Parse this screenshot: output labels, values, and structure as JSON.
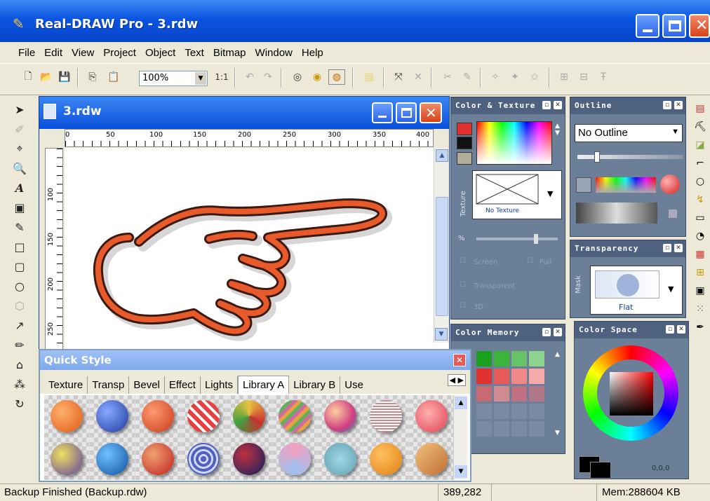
{
  "window": {
    "title": "Real-DRAW Pro - 3.rdw"
  },
  "menu": [
    "File",
    "Edit",
    "View",
    "Project",
    "Object",
    "Text",
    "Bitmap",
    "Window",
    "Help"
  ],
  "toolbar": {
    "zoom": "100%",
    "ratio": "1:1"
  },
  "doc": {
    "title": "3.rdw",
    "ruler_h": [
      "0",
      "50",
      "100",
      "150",
      "200",
      "250",
      "300",
      "350",
      "400"
    ],
    "ruler_v": [
      "100",
      "150",
      "200",
      "250"
    ]
  },
  "panels": {
    "color_texture": {
      "title": "Color & Texture",
      "side_label": "Texture",
      "texture_name": "No Texture",
      "check1": "Screen",
      "check2": "Full",
      "check3": "Transparent",
      "check4": "3D"
    },
    "outline": {
      "title": "Outline",
      "select": "No Outline"
    },
    "transparency": {
      "title": "Transparency",
      "side_label": "Mask",
      "mode": "Flat"
    },
    "color_memory": {
      "title": "Color Memory"
    },
    "color_space": {
      "title": "Color Space",
      "value": "0,0,0"
    }
  },
  "quick_style": {
    "title": "Quick Style",
    "tabs": [
      "Texture",
      "Transp",
      "Bevel",
      "Effect",
      "Lights",
      "Library A",
      "Library B",
      "Use"
    ],
    "active_tab": "Library A"
  },
  "status": {
    "message": "Backup Finished (Backup.rdw)",
    "coords": "389,282",
    "memory": "Mem:288604 KB"
  },
  "colors": {
    "accent": "#0a54e0",
    "panel": "#6c7f99"
  }
}
